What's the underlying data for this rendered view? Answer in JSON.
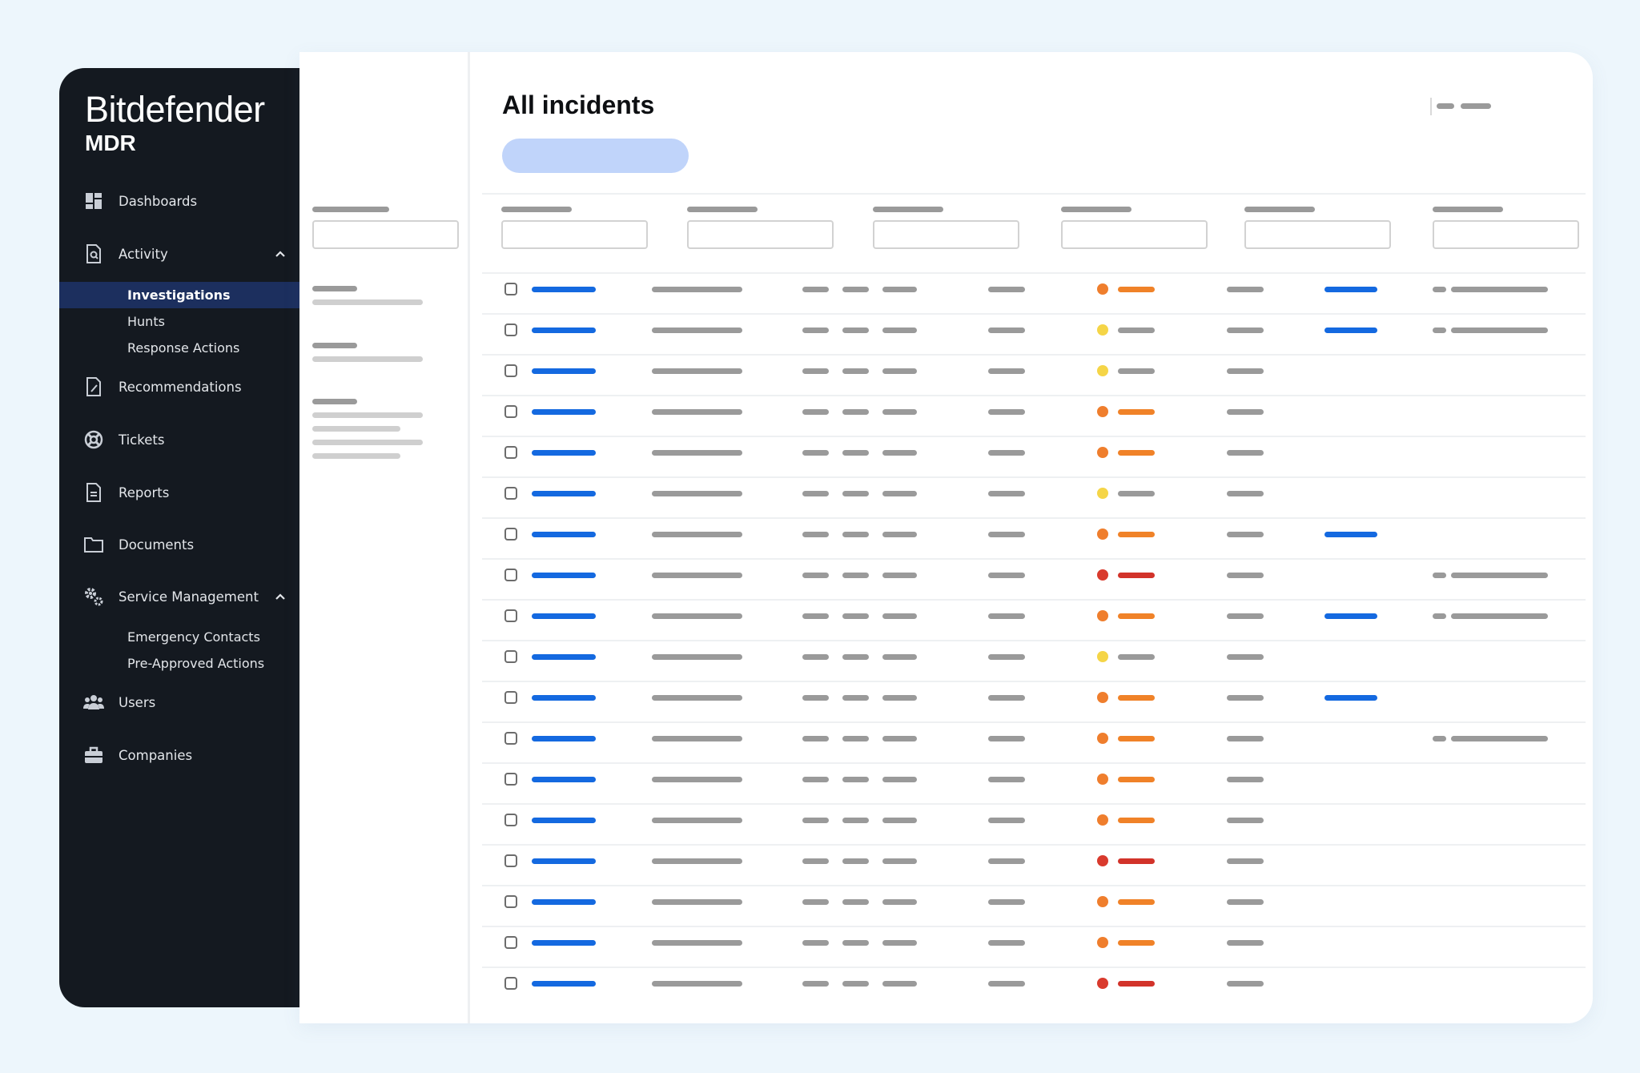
{
  "app": {
    "brand_name": "Bitdefender",
    "brand_product": "MDR"
  },
  "sidebar": {
    "items": [
      {
        "label": "Dashboards",
        "icon": "dashboard-icon"
      },
      {
        "label": "Activity",
        "icon": "activity-search-icon",
        "expanded": true,
        "children": [
          {
            "label": "Investigations",
            "active": true
          },
          {
            "label": "Hunts"
          },
          {
            "label": "Response Actions"
          }
        ]
      },
      {
        "label": "Recommendations",
        "icon": "document-pen-icon"
      },
      {
        "label": "Tickets",
        "icon": "lifebuoy-icon"
      },
      {
        "label": "Reports",
        "icon": "report-icon"
      },
      {
        "label": "Documents",
        "icon": "folder-icon"
      },
      {
        "label": "Service Management",
        "icon": "gears-icon",
        "expanded": true,
        "children": [
          {
            "label": "Emergency Contacts"
          },
          {
            "label": "Pre-Approved Actions"
          }
        ]
      },
      {
        "label": "Users",
        "icon": "users-icon"
      },
      {
        "label": "Companies",
        "icon": "briefcase-icon"
      }
    ]
  },
  "main": {
    "title": "All incidents"
  },
  "colors": {
    "sidebar_bg": "#141920",
    "active_item_bg": "#1c2f5e",
    "link_blue": "#1469e0",
    "severity_high": "#f08228",
    "severity_critical": "#d2332a",
    "severity_medium": "#f5d547",
    "cta_bg": "#c0d4fa"
  },
  "table": {
    "row_severities": [
      "orange",
      "yellow",
      "yellow",
      "orange",
      "orange",
      "yellow",
      "orange",
      "red",
      "orange",
      "yellow",
      "orange",
      "orange",
      "orange",
      "orange",
      "red",
      "orange",
      "orange",
      "red"
    ],
    "rows_with_col7_link": [
      0,
      1,
      6,
      8,
      10
    ],
    "rows_with_col8_value": [
      0,
      1,
      7,
      8,
      11
    ]
  }
}
